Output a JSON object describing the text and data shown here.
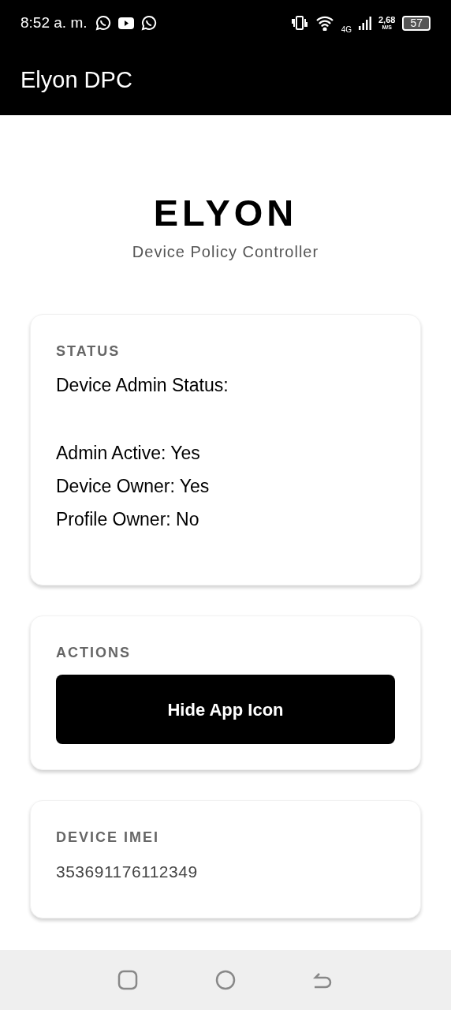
{
  "status_bar": {
    "time": "8:52 a. m.",
    "network": "4G",
    "speed_value": "2,68",
    "speed_unit": "M/S",
    "battery": "57"
  },
  "app_bar": {
    "title": "Elyon DPC"
  },
  "header": {
    "title": "ELYON",
    "subtitle": "Device Policy Controller"
  },
  "status_card": {
    "heading": "STATUS",
    "intro": "Device Admin Status:",
    "lines": [
      "Admin Active: Yes",
      "Device Owner: Yes",
      "Profile Owner: No"
    ]
  },
  "actions_card": {
    "heading": "ACTIONS",
    "button": "Hide App Icon"
  },
  "imei_card": {
    "heading": "DEVICE IMEI",
    "value": "353691176112349"
  }
}
